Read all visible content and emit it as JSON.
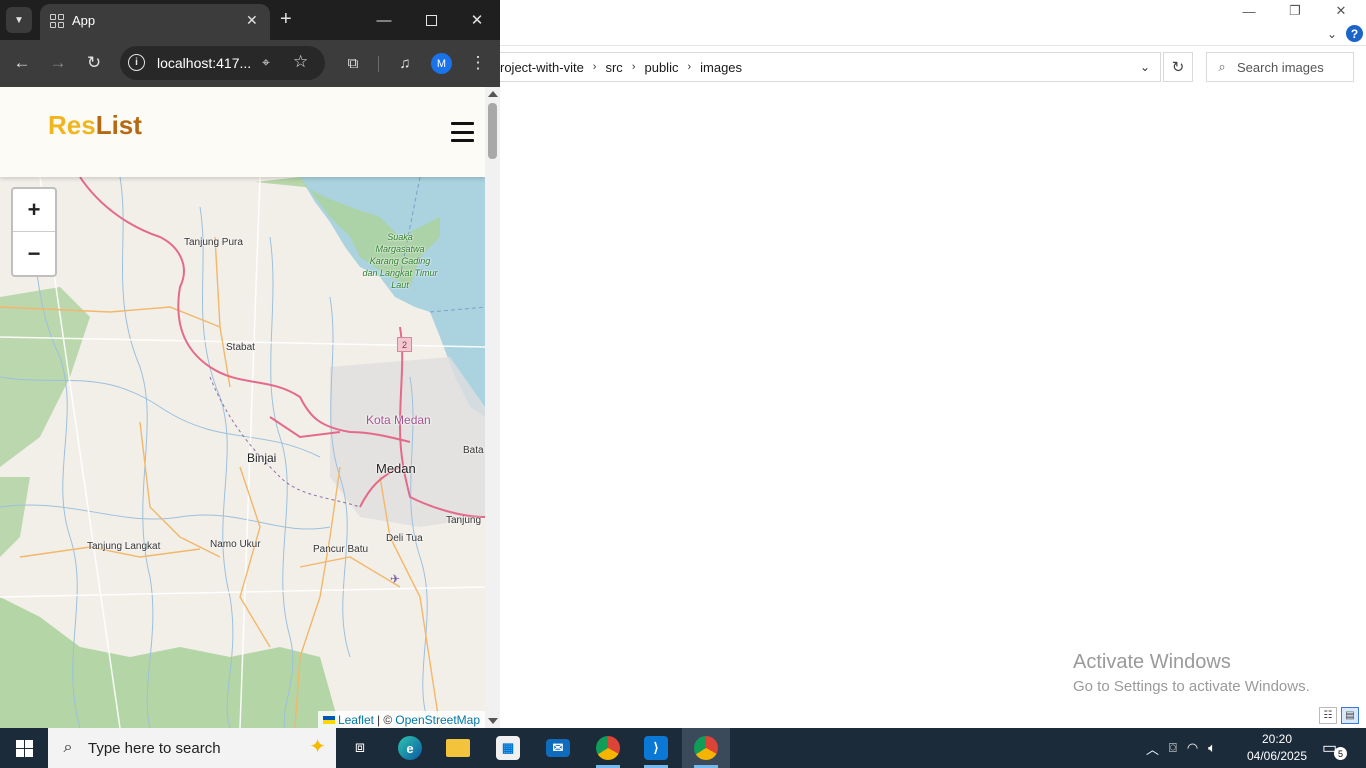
{
  "explorer": {
    "breadcrumb": [
      "roject-with-vite",
      "src",
      "public",
      "images"
    ],
    "search_placeholder": "Search images",
    "help_label": "?",
    "watermark_title": "Activate Windows",
    "watermark_sub": "Go to Settings to activate Windows."
  },
  "chrome": {
    "tab_title": "App",
    "url": "localhost:417...",
    "profile_initial": "M"
  },
  "page": {
    "brand_part1": "Res",
    "brand_part2": "List",
    "zoom_in": "+",
    "zoom_out": "−",
    "attribution_leaflet": "Leaflet",
    "attribution_sep": "| ©",
    "attribution_osm": "OpenStreetMap"
  },
  "map": {
    "labels": [
      {
        "id": "tanjung-pura",
        "text": "Tanjung Pura"
      },
      {
        "id": "stabat",
        "text": "Stabat"
      },
      {
        "id": "binjai",
        "text": "Binjai"
      },
      {
        "id": "medan",
        "text": "Medan"
      },
      {
        "id": "kota-medan",
        "text": "Kota Medan"
      },
      {
        "id": "batang",
        "text": "Bata"
      },
      {
        "id": "tanjung-east",
        "text": "Tanjung"
      },
      {
        "id": "tanjung-langkat",
        "text": "Tanjung Langkat"
      },
      {
        "id": "namo-ukur",
        "text": "Namo Ukur"
      },
      {
        "id": "pancur-batu",
        "text": "Pancur Batu"
      },
      {
        "id": "deli-tua",
        "text": "Deli Tua"
      },
      {
        "id": "suaka",
        "text": "Suaka Margasatwa Karang Gading dan Langkat Timur Laut"
      }
    ],
    "route_number": "2"
  },
  "taskbar": {
    "search_placeholder": "Type here to search",
    "time": "20:20",
    "date": "04/06/2025",
    "notification_count": "5"
  },
  "colors": {
    "brand_yellow": "#f1b51d",
    "brand_brown": "#b56912",
    "chrome_dark": "#1f1f1f",
    "taskbar": "#1c2b3a",
    "map_bg": "#f2efe9",
    "water": "#aad3df",
    "forest": "#add19e"
  }
}
